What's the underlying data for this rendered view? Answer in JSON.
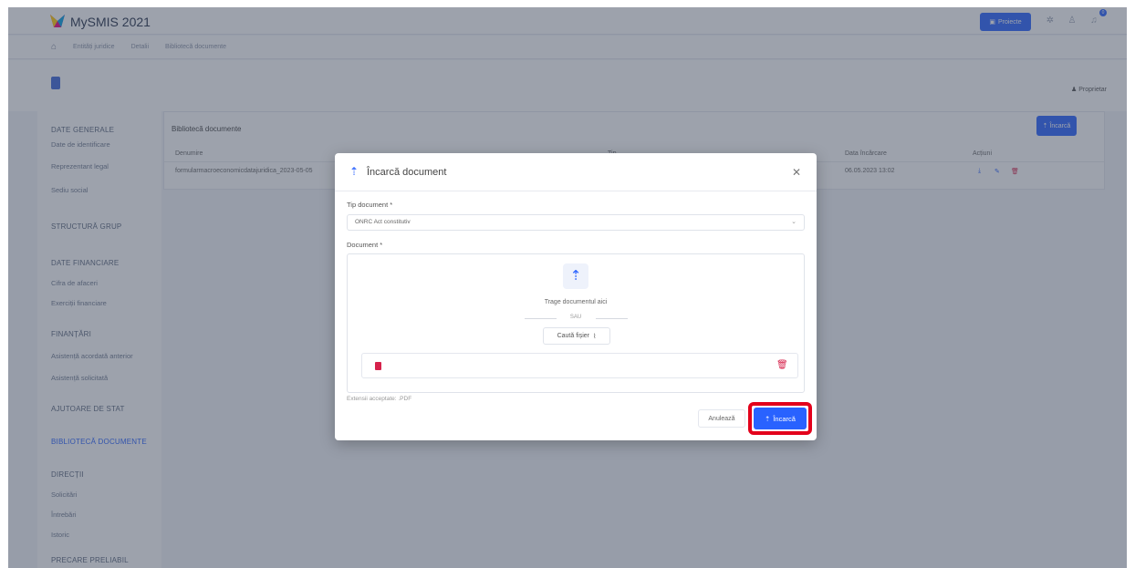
{
  "app": {
    "title": "MySMIS 2021"
  },
  "topbar": {
    "projects_label": "Proiecte",
    "notification_count": "0"
  },
  "breadcrumb": {
    "items": [
      "Entități juridice",
      "Detalii",
      "Bibliotecă documente"
    ]
  },
  "page": {
    "owner_label": "Proprietar"
  },
  "sidebar": {
    "items": [
      "DATE GENERALE",
      "Date de identificare",
      "Reprezentant legal",
      "Sediu social",
      "STRUCTURĂ GRUP",
      "DATE FINANCIARE",
      "Cifra de afaceri",
      "Exerciții financiare",
      "FINANȚĂRI",
      "Asistență acordată anterior",
      "Asistență solicitată",
      "AJUTOARE DE STAT",
      "BIBLIOTECĂ DOCUMENTE",
      "DIRECȚII",
      "Solicitări",
      "Întrebări",
      "Istoric",
      "PRECARE PRELIABIL"
    ],
    "active": "BIBLIOTECĂ DOCUMENTE"
  },
  "card": {
    "title": "Bibliotecă documente",
    "upload_label": "Încarcă",
    "columns": [
      "Denumire",
      "Tip",
      "Data încărcare",
      "Acțiuni"
    ],
    "row": {
      "name": "formularmacroeconomicdatajuridica_2023-05-05",
      "date": "06.05.2023 13:02"
    }
  },
  "modal": {
    "title": "Încarcă document",
    "doc_type_label": "Tip document *",
    "doc_type_value": "ONRC Act constitutiv",
    "document_label": "Document *",
    "drop_text": "Trage documentul aici",
    "or_text": "SAU",
    "browse_label": "Caută fișier",
    "extension_note": "Extensii acceptate: .PDF",
    "cancel_label": "Anulează",
    "submit_label": "Încarcă"
  },
  "colors": {
    "accent": "#2962ff",
    "danger": "#d6224b",
    "highlight": "#e3001b"
  },
  "icons": [
    "home-icon",
    "upload-icon",
    "close-icon",
    "chevron-down-icon",
    "paperclip-icon",
    "pdf-file-icon",
    "trash-icon",
    "bell-icon",
    "user-icon",
    "settings-icon"
  ]
}
